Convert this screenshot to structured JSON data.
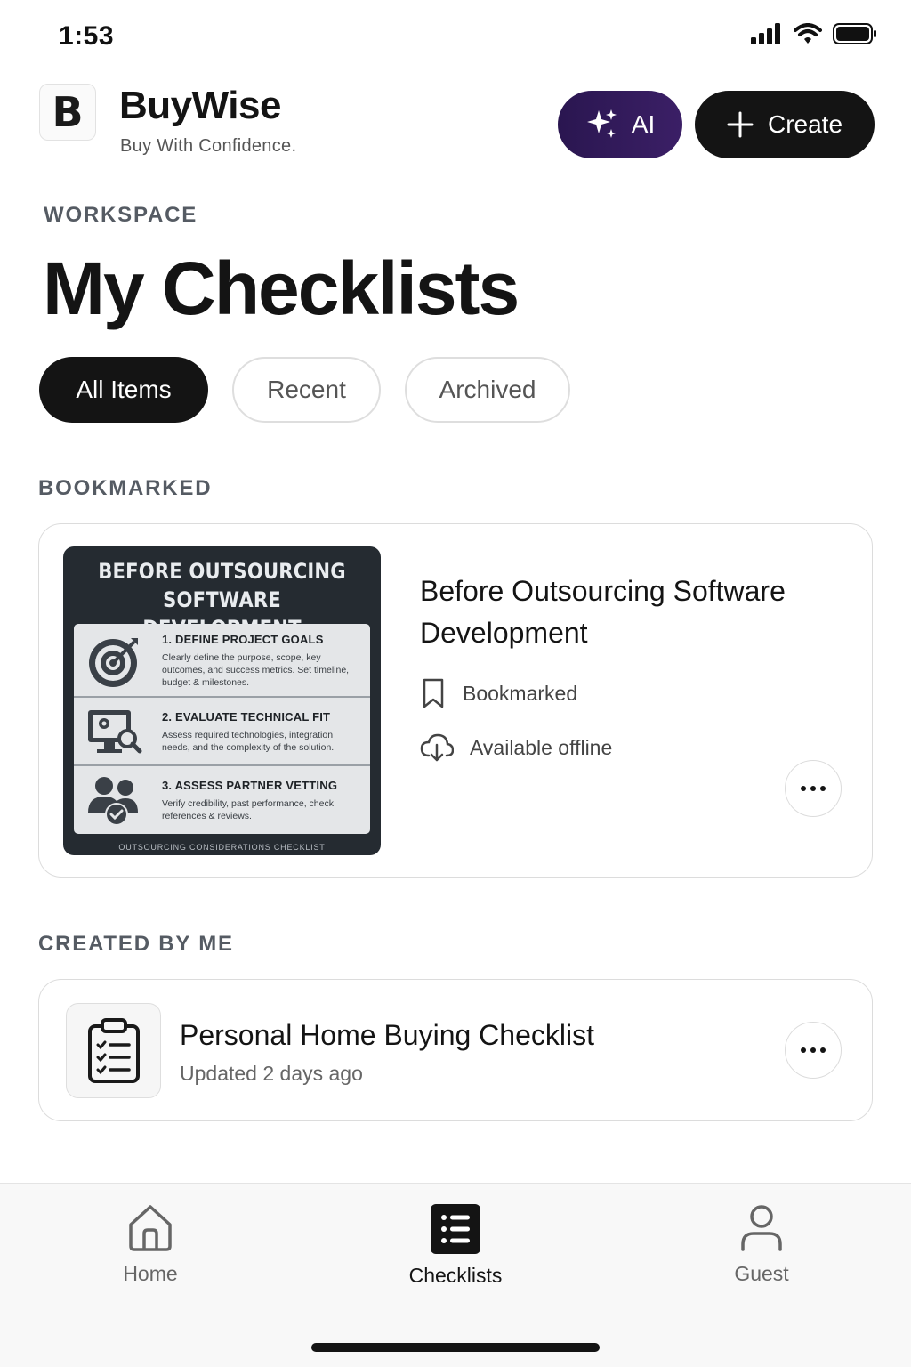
{
  "status_bar": {
    "time": "1:53"
  },
  "brand": {
    "logo_letter": "B",
    "name": "BuyWise",
    "tagline": "Buy With Confidence."
  },
  "header_actions": {
    "ai_label": "AI",
    "create_label": "Create"
  },
  "workspace": {
    "label": "WORKSPACE",
    "title": "My Checklists"
  },
  "tabs": [
    {
      "label": "All Items",
      "active": true
    },
    {
      "label": "Recent",
      "active": false
    },
    {
      "label": "Archived",
      "active": false
    }
  ],
  "bookmarked": {
    "label": "BOOKMARKED",
    "card": {
      "title": "Before Outsourcing Software Development",
      "status_bookmarked": "Bookmarked",
      "status_offline": "Available offline",
      "thumbnail": {
        "title_line1": "BEFORE OUTSOURCING",
        "title_line2": "SOFTWARE DEVELOPMENT",
        "steps": [
          {
            "title": "1. DEFINE PROJECT GOALS",
            "text": "Clearly define the purpose, scope, key outcomes, and success metrics. Set timeline, budget & milestones.",
            "icon": "target-icon"
          },
          {
            "title": "2. EVALUATE TECHNICAL FIT",
            "text": "Assess required technologies, integration needs, and the complexity of the solution.",
            "icon": "monitor-search-icon"
          },
          {
            "title": "3. ASSESS PARTNER VETTING",
            "text": "Verify credibility, past performance, check references & reviews.",
            "icon": "people-check-icon"
          }
        ],
        "footer": "OUTSOURCING CONSIDERATIONS CHECKLIST"
      }
    }
  },
  "created_by_me": {
    "label": "CREATED BY ME",
    "items": [
      {
        "title": "Personal Home Buying Checklist",
        "subtitle": "Updated 2 days ago"
      }
    ]
  },
  "bottom_nav": [
    {
      "label": "Home",
      "icon": "home-icon",
      "active": false
    },
    {
      "label": "Checklists",
      "icon": "checklist-icon",
      "active": true
    },
    {
      "label": "Guest",
      "icon": "user-icon",
      "active": false
    }
  ],
  "colors": {
    "primary": "#141414",
    "ai_button": "#2a1650",
    "muted_text": "#555b63"
  }
}
